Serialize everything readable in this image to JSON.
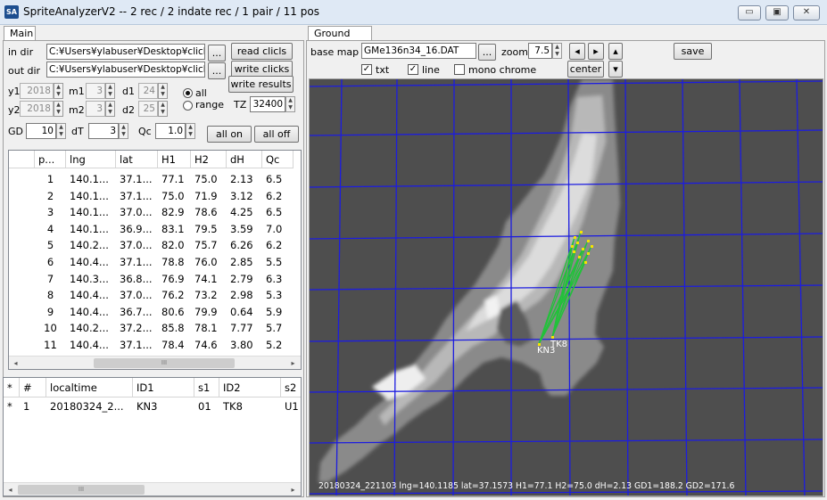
{
  "window": {
    "icon": "SA",
    "title": "SpriteAnalyzerV2 --  2 rec  / 2 indate rec / 1 pair / 11 pos",
    "controls": {
      "minimize": "▭",
      "maximize": "▣",
      "close": "✕"
    }
  },
  "tabs": {
    "main": "Main",
    "ground_map": "Ground Map"
  },
  "main": {
    "in_dir_label": "in dir",
    "in_dir": "C:¥Users¥ylabuser¥Desktop¥clicks",
    "out_dir_label": "out dir",
    "out_dir": "C:¥Users¥ylabuser¥Desktop¥clicks",
    "browse": "...",
    "read": "read clicls",
    "write": "write clicks",
    "write_results": "write results",
    "y1_label": "y1",
    "y1": "2018",
    "m1_label": "m1",
    "m1": "3",
    "d1_label": "d1",
    "d1": "24",
    "y2_label": "y2",
    "y2": "2018",
    "m2_label": "m2",
    "m2": "3",
    "d2_label": "d2",
    "d2": "25",
    "all": "all",
    "range": "range",
    "tz_label": "TZ",
    "tz": "32400",
    "gd_label": "GD",
    "gd": "10",
    "dt_label": "dT",
    "dt": "3",
    "qc_label": "Qc",
    "qc": "1.0",
    "all_on": "all on",
    "all_off": "all off"
  },
  "points_table": {
    "columns": [
      "p...",
      "lng",
      "lat",
      "H1",
      "H2",
      "dH",
      "Qc"
    ],
    "rows": [
      [
        "1",
        "140.1...",
        "37.1...",
        "77.1",
        "75.0",
        "2.13",
        "6.5"
      ],
      [
        "2",
        "140.1...",
        "37.1...",
        "75.0",
        "71.9",
        "3.12",
        "6.2"
      ],
      [
        "3",
        "140.1...",
        "37.0...",
        "82.9",
        "78.6",
        "4.25",
        "6.5"
      ],
      [
        "4",
        "140.1...",
        "36.9...",
        "83.1",
        "79.5",
        "3.59",
        "7.0"
      ],
      [
        "5",
        "140.2...",
        "37.0...",
        "82.0",
        "75.7",
        "6.26",
        "6.2"
      ],
      [
        "6",
        "140.4...",
        "37.1...",
        "78.8",
        "76.0",
        "2.85",
        "5.5"
      ],
      [
        "7",
        "140.3...",
        "36.8...",
        "76.9",
        "74.1",
        "2.79",
        "6.3"
      ],
      [
        "8",
        "140.4...",
        "37.0...",
        "76.2",
        "73.2",
        "2.98",
        "5.3"
      ],
      [
        "9",
        "140.4...",
        "36.7...",
        "80.6",
        "79.9",
        "0.64",
        "5.9"
      ],
      [
        "10",
        "140.2...",
        "37.2...",
        "85.8",
        "78.1",
        "7.77",
        "5.7"
      ],
      [
        "11",
        "140.4...",
        "37.1...",
        "78.4",
        "74.6",
        "3.80",
        "5.2"
      ]
    ],
    "scroll_left": "◂",
    "scroll_right": "▸",
    "scroll_thumb": "III"
  },
  "pairs_table": {
    "columns": [
      "*",
      "#",
      "localtime",
      "ID1",
      "s1",
      "ID2",
      "s2"
    ],
    "rows": [
      [
        "*",
        "1",
        "20180324_2...",
        "KN3",
        "01",
        "TK8",
        "U1"
      ]
    ],
    "scroll_left": "◂",
    "scroll_right": "▸",
    "scroll_thumb": "III"
  },
  "ground": {
    "base_map_label": "base map",
    "base_map": "GMe136n34_16.DAT",
    "browse": "...",
    "zoom_label": "zoom",
    "zoom": "7.5",
    "prev": "◂",
    "next": "▸",
    "up": "▴",
    "down": "▾",
    "save": "save",
    "txt": "txt",
    "line": "line",
    "mono": "mono chrome",
    "center": "center",
    "station1": "KN3",
    "station2": "TK8",
    "status": "20180324_221103 lng=140.1185 lat=37.1573 H1=77.1 H2=75.0 dH=2.13 GD1=188.2 GD2=171.6"
  },
  "colors": {
    "map_bg": "#4e4e4e",
    "grid": "#1c1ce0",
    "rays": "#22c23a",
    "points": "#f5e500",
    "text": "#ffffff"
  }
}
